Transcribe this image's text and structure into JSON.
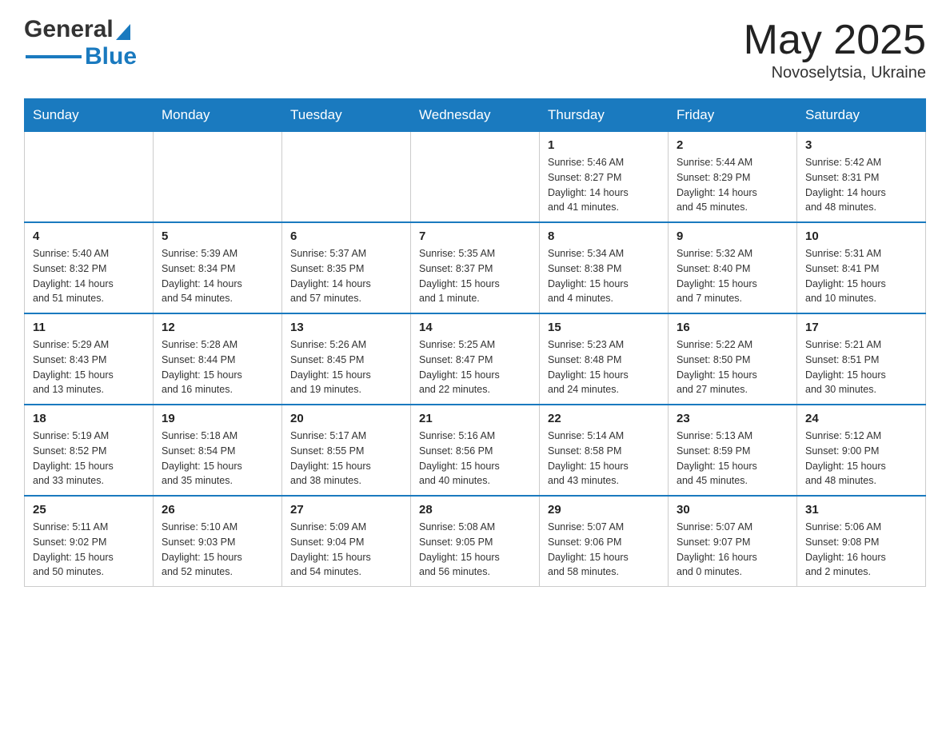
{
  "header": {
    "logo_general": "General",
    "logo_blue": "Blue",
    "title": "May 2025",
    "location": "Novoselytsia, Ukraine"
  },
  "calendar": {
    "days_of_week": [
      "Sunday",
      "Monday",
      "Tuesday",
      "Wednesday",
      "Thursday",
      "Friday",
      "Saturday"
    ],
    "weeks": [
      [
        {
          "day": "",
          "info": ""
        },
        {
          "day": "",
          "info": ""
        },
        {
          "day": "",
          "info": ""
        },
        {
          "day": "",
          "info": ""
        },
        {
          "day": "1",
          "info": "Sunrise: 5:46 AM\nSunset: 8:27 PM\nDaylight: 14 hours\nand 41 minutes."
        },
        {
          "day": "2",
          "info": "Sunrise: 5:44 AM\nSunset: 8:29 PM\nDaylight: 14 hours\nand 45 minutes."
        },
        {
          "day": "3",
          "info": "Sunrise: 5:42 AM\nSunset: 8:31 PM\nDaylight: 14 hours\nand 48 minutes."
        }
      ],
      [
        {
          "day": "4",
          "info": "Sunrise: 5:40 AM\nSunset: 8:32 PM\nDaylight: 14 hours\nand 51 minutes."
        },
        {
          "day": "5",
          "info": "Sunrise: 5:39 AM\nSunset: 8:34 PM\nDaylight: 14 hours\nand 54 minutes."
        },
        {
          "day": "6",
          "info": "Sunrise: 5:37 AM\nSunset: 8:35 PM\nDaylight: 14 hours\nand 57 minutes."
        },
        {
          "day": "7",
          "info": "Sunrise: 5:35 AM\nSunset: 8:37 PM\nDaylight: 15 hours\nand 1 minute."
        },
        {
          "day": "8",
          "info": "Sunrise: 5:34 AM\nSunset: 8:38 PM\nDaylight: 15 hours\nand 4 minutes."
        },
        {
          "day": "9",
          "info": "Sunrise: 5:32 AM\nSunset: 8:40 PM\nDaylight: 15 hours\nand 7 minutes."
        },
        {
          "day": "10",
          "info": "Sunrise: 5:31 AM\nSunset: 8:41 PM\nDaylight: 15 hours\nand 10 minutes."
        }
      ],
      [
        {
          "day": "11",
          "info": "Sunrise: 5:29 AM\nSunset: 8:43 PM\nDaylight: 15 hours\nand 13 minutes."
        },
        {
          "day": "12",
          "info": "Sunrise: 5:28 AM\nSunset: 8:44 PM\nDaylight: 15 hours\nand 16 minutes."
        },
        {
          "day": "13",
          "info": "Sunrise: 5:26 AM\nSunset: 8:45 PM\nDaylight: 15 hours\nand 19 minutes."
        },
        {
          "day": "14",
          "info": "Sunrise: 5:25 AM\nSunset: 8:47 PM\nDaylight: 15 hours\nand 22 minutes."
        },
        {
          "day": "15",
          "info": "Sunrise: 5:23 AM\nSunset: 8:48 PM\nDaylight: 15 hours\nand 24 minutes."
        },
        {
          "day": "16",
          "info": "Sunrise: 5:22 AM\nSunset: 8:50 PM\nDaylight: 15 hours\nand 27 minutes."
        },
        {
          "day": "17",
          "info": "Sunrise: 5:21 AM\nSunset: 8:51 PM\nDaylight: 15 hours\nand 30 minutes."
        }
      ],
      [
        {
          "day": "18",
          "info": "Sunrise: 5:19 AM\nSunset: 8:52 PM\nDaylight: 15 hours\nand 33 minutes."
        },
        {
          "day": "19",
          "info": "Sunrise: 5:18 AM\nSunset: 8:54 PM\nDaylight: 15 hours\nand 35 minutes."
        },
        {
          "day": "20",
          "info": "Sunrise: 5:17 AM\nSunset: 8:55 PM\nDaylight: 15 hours\nand 38 minutes."
        },
        {
          "day": "21",
          "info": "Sunrise: 5:16 AM\nSunset: 8:56 PM\nDaylight: 15 hours\nand 40 minutes."
        },
        {
          "day": "22",
          "info": "Sunrise: 5:14 AM\nSunset: 8:58 PM\nDaylight: 15 hours\nand 43 minutes."
        },
        {
          "day": "23",
          "info": "Sunrise: 5:13 AM\nSunset: 8:59 PM\nDaylight: 15 hours\nand 45 minutes."
        },
        {
          "day": "24",
          "info": "Sunrise: 5:12 AM\nSunset: 9:00 PM\nDaylight: 15 hours\nand 48 minutes."
        }
      ],
      [
        {
          "day": "25",
          "info": "Sunrise: 5:11 AM\nSunset: 9:02 PM\nDaylight: 15 hours\nand 50 minutes."
        },
        {
          "day": "26",
          "info": "Sunrise: 5:10 AM\nSunset: 9:03 PM\nDaylight: 15 hours\nand 52 minutes."
        },
        {
          "day": "27",
          "info": "Sunrise: 5:09 AM\nSunset: 9:04 PM\nDaylight: 15 hours\nand 54 minutes."
        },
        {
          "day": "28",
          "info": "Sunrise: 5:08 AM\nSunset: 9:05 PM\nDaylight: 15 hours\nand 56 minutes."
        },
        {
          "day": "29",
          "info": "Sunrise: 5:07 AM\nSunset: 9:06 PM\nDaylight: 15 hours\nand 58 minutes."
        },
        {
          "day": "30",
          "info": "Sunrise: 5:07 AM\nSunset: 9:07 PM\nDaylight: 16 hours\nand 0 minutes."
        },
        {
          "day": "31",
          "info": "Sunrise: 5:06 AM\nSunset: 9:08 PM\nDaylight: 16 hours\nand 2 minutes."
        }
      ]
    ]
  }
}
